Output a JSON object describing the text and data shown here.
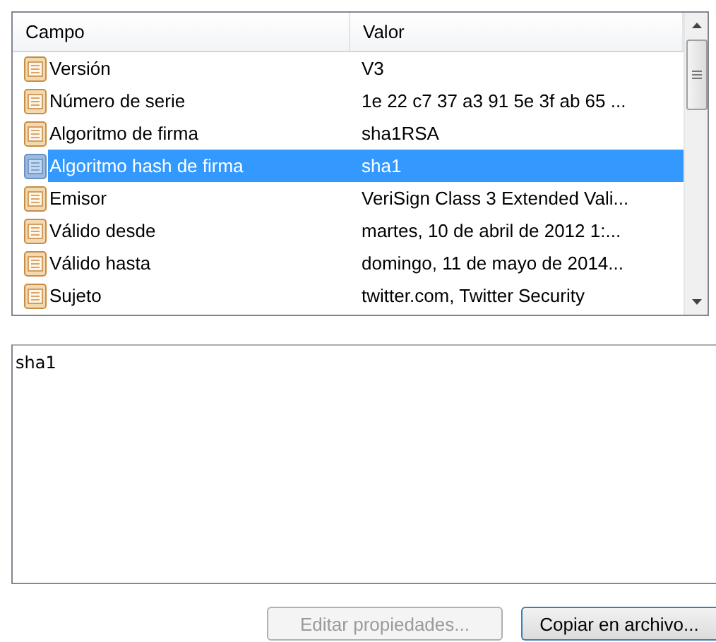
{
  "table": {
    "columns": [
      "Campo",
      "Valor"
    ],
    "rows": [
      {
        "field": "Versión",
        "value": "V3",
        "selected": false
      },
      {
        "field": "Número de serie",
        "value": "1e 22 c7 37 a3 91 5e 3f ab 65 ...",
        "selected": false
      },
      {
        "field": "Algoritmo de firma",
        "value": "sha1RSA",
        "selected": false
      },
      {
        "field": "Algoritmo hash de firma",
        "value": "sha1",
        "selected": true
      },
      {
        "field": "Emisor",
        "value": "VeriSign Class 3 Extended Vali...",
        "selected": false
      },
      {
        "field": "Válido desde",
        "value": "martes, 10 de abril de 2012 1:...",
        "selected": false
      },
      {
        "field": "Válido hasta",
        "value": "domingo, 11 de mayo de 2014...",
        "selected": false
      },
      {
        "field": "Sujeto",
        "value": "twitter.com, Twitter Security",
        "selected": false
      }
    ]
  },
  "detail": {
    "value": "sha1"
  },
  "buttons": [
    {
      "label": "Editar propiedades...",
      "disabled": true
    },
    {
      "label": "Copiar en archivo...",
      "disabled": false
    }
  ]
}
